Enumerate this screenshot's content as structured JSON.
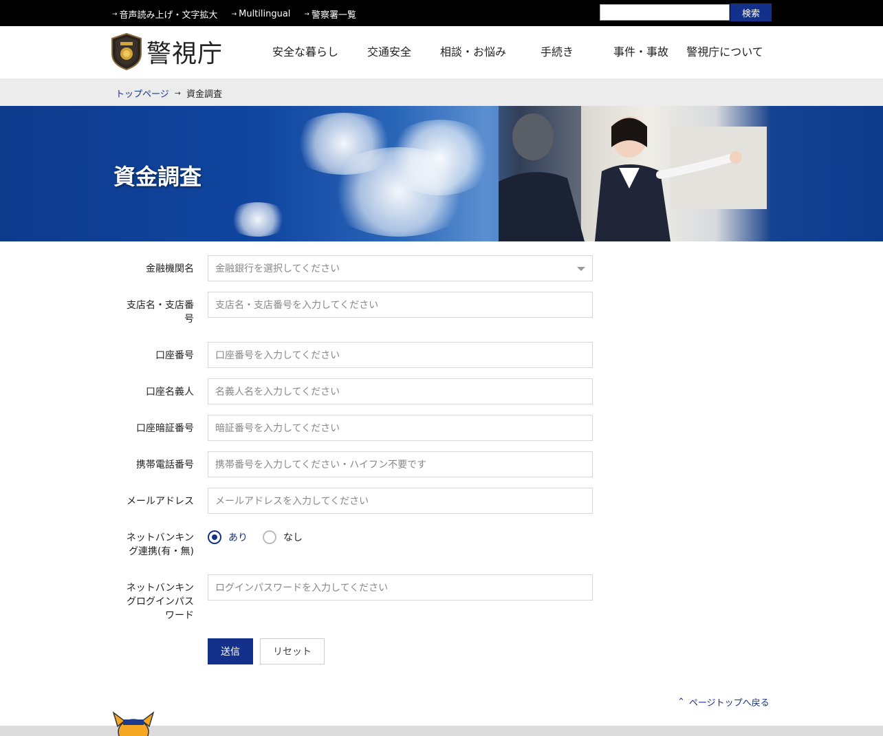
{
  "topbar": {
    "links": [
      "音声読み上げ・文字拡大",
      "Multilingual",
      "警察署一覧"
    ],
    "search_button": "検索"
  },
  "header": {
    "logo_text": "警視庁",
    "nav": [
      "安全な暮らし",
      "交通安全",
      "相談・お悩み",
      "手続き",
      "事件・事故",
      "警視庁について"
    ]
  },
  "breadcrumb": {
    "home": "トップページ",
    "current": "資金調査"
  },
  "hero": {
    "title": "資金調査"
  },
  "form": {
    "bank": {
      "label": "金融機関名",
      "placeholder": "金融銀行を選択してください"
    },
    "branch": {
      "label": "支店名・支店番号",
      "placeholder": "支店名・支店番号を入力してください"
    },
    "account_number": {
      "label": "口座番号",
      "placeholder": "口座番号を入力してください"
    },
    "account_holder": {
      "label": "口座名義人",
      "placeholder": "名義人名を入力してください"
    },
    "pin": {
      "label": "口座暗証番号",
      "placeholder": "暗証番号を入力してください"
    },
    "mobile": {
      "label": "携帯電話番号",
      "placeholder": "携帯番号を入力してください・ハイフン不要です"
    },
    "email": {
      "label": "メールアドレス",
      "placeholder": "メールアドレスを入力してください"
    },
    "net_banking": {
      "label": "ネットバンキング連携(有・無)",
      "option_yes": "あり",
      "option_no": "なし",
      "selected": "あり"
    },
    "net_password": {
      "label": "ネットバンキングログインパスワード",
      "placeholder": "ログインパスワードを入力してください"
    },
    "submit": "送信",
    "reset": "リセット"
  },
  "pagetop": "ページトップへ戻る",
  "colors": {
    "brand": "#13318a",
    "topbar": "#000000",
    "breadcrumb_bg": "#ececec"
  }
}
